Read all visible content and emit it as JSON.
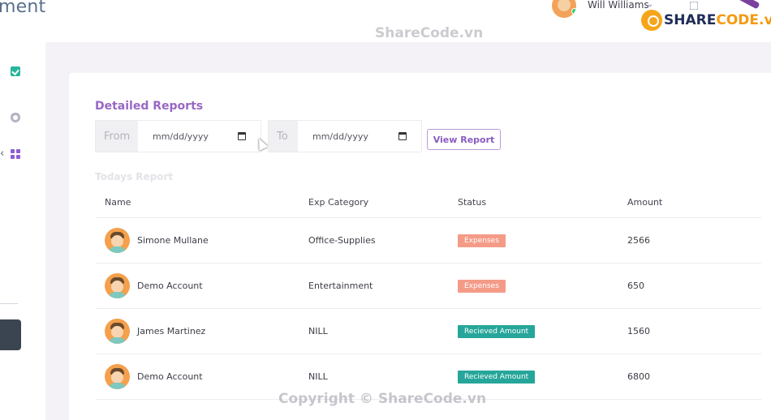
{
  "header": {
    "app_title_fragment": "ment",
    "user_name": "Will Williams",
    "caret_icon": "chevron-down-icon",
    "brand": {
      "name_prefix": "SHARE",
      "name_suffix": "CODE.vn",
      "accent_color": "#f59a12"
    }
  },
  "sidebar": {
    "icons": [
      "checklist-icon",
      "shield-icon",
      "grid-icon",
      "chevron-left-icon"
    ]
  },
  "watermarks": {
    "top": "ShareCode.vn",
    "bottom": "Copyright © ShareCode.vn"
  },
  "report": {
    "title": "Detailed Reports",
    "from_label": "From",
    "to_label": "To",
    "from_placeholder": "mm/dd/yyyy",
    "to_placeholder": "mm/dd/yyyy",
    "view_button": "View Report",
    "subheading": "Todays Report",
    "columns": [
      "Name",
      "Exp Category",
      "Status",
      "Amount"
    ],
    "rows": [
      {
        "name": "Simone Mullane",
        "category": "Office-Supplies",
        "status": "Expenses",
        "amount": "2566"
      },
      {
        "name": "Demo Account",
        "category": "Entertainment",
        "status": "Expenses",
        "amount": "650"
      },
      {
        "name": "James Martinez",
        "category": "NILL",
        "status": "Recieved Amount",
        "amount": "1560"
      },
      {
        "name": "Demo Account",
        "category": "NILL",
        "status": "Recieved Amount",
        "amount": "6800"
      }
    ]
  },
  "colors": {
    "accent": "#9867c5",
    "expense_badge": "#f49b88",
    "received_badge": "#26a69a"
  }
}
